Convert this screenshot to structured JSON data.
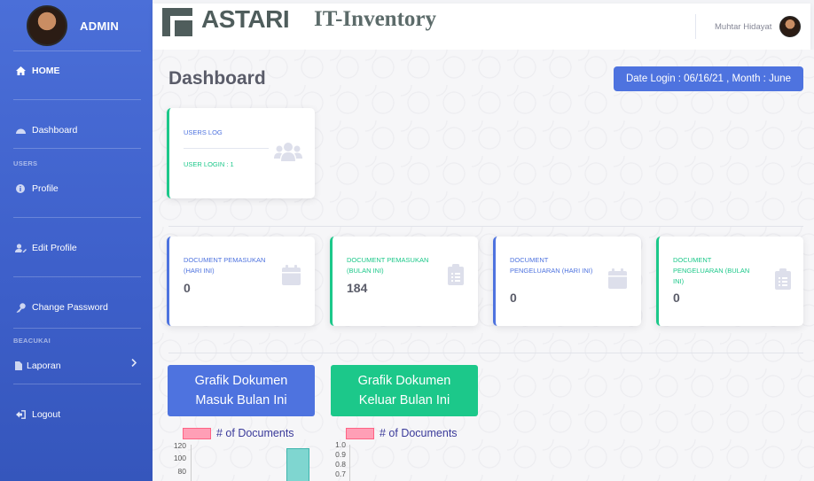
{
  "sidebar": {
    "brand": "ADMIN",
    "home": "HOME",
    "dashboard": "Dashboard",
    "section_users": "USERS",
    "profile": "Profile",
    "edit_profile": "Edit Profile",
    "change_password": "Change Password",
    "section_beacukai": "BEACUKAI",
    "laporan": "Laporan",
    "logout": "Logout"
  },
  "topbar": {
    "logo_main": "ASTARI",
    "logo_sub": "IT-Inventory",
    "user_name": "Muhtar Hidayat"
  },
  "main": {
    "title": "Dashboard",
    "date_button": "Date Login : 06/16/21 , Month : June",
    "users_log": {
      "title": "USERS LOG",
      "subtitle": "USER LOGIN : 1"
    },
    "stats": [
      {
        "title": "DOCUMENT PEMASUKAN (HARI INI)",
        "value": "0"
      },
      {
        "title": "DOCUMENT PEMASUKAN (BULAN INI)",
        "value": "184"
      },
      {
        "title": "DOCUMENT PENGELUARAN (HARI INI)",
        "value": "0"
      },
      {
        "title": "DOCUMENT PENGELUARAN (BULAN INI)",
        "value": "0"
      }
    ],
    "chart_buttons": [
      {
        "line1": "Grafik Dokumen",
        "line2": "Masuk Bulan Ini"
      },
      {
        "line1": "Grafik Dokumen",
        "line2": "Keluar Bulan Ini"
      }
    ]
  },
  "chart_data": [
    {
      "type": "bar",
      "legend": [
        "# of Documents"
      ],
      "y_ticks": [
        "120",
        "100",
        "80"
      ],
      "ylim": [
        0,
        120
      ],
      "values": [
        115
      ],
      "grid": true
    },
    {
      "type": "bar",
      "legend": [
        "# of Documents"
      ],
      "y_ticks": [
        "1.0",
        "0.9",
        "0.8",
        "0.7"
      ],
      "ylim": [
        0,
        1.0
      ],
      "values": [],
      "grid": true
    }
  ],
  "colors": {
    "primary": "#4e73df",
    "success": "#1cc88a",
    "legend_fill": "#ff9fb6",
    "bar_fill": "#7fd6d0"
  }
}
